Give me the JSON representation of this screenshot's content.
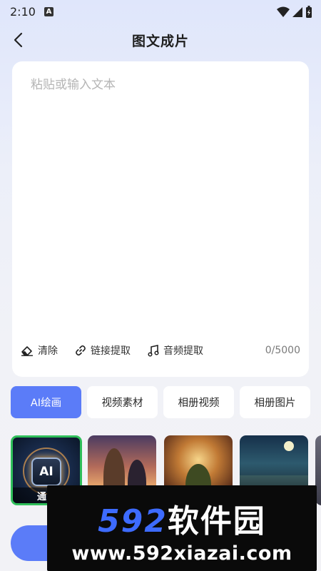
{
  "status_bar": {
    "time": "2:10",
    "notification_badge": "A"
  },
  "header": {
    "title": "图文成片"
  },
  "editor": {
    "placeholder": "粘贴或输入文本",
    "value": "",
    "tools": {
      "clear": "清除",
      "link_extract": "链接提取",
      "audio_extract": "音频提取"
    },
    "counter": "0/5000"
  },
  "tabs": [
    {
      "label": "AI绘画",
      "active": true
    },
    {
      "label": "视频素材",
      "active": false
    },
    {
      "label": "相册视频",
      "active": false
    },
    {
      "label": "相册图片",
      "active": false
    }
  ],
  "styles": [
    {
      "label": "通",
      "chip": "AI",
      "selected": true
    }
  ],
  "watermark": {
    "number": "592",
    "name": "软件园",
    "url": "www.592xiazai.com"
  },
  "colors": {
    "accent": "#5b7cf8",
    "selected_border": "#2fbf5a"
  }
}
